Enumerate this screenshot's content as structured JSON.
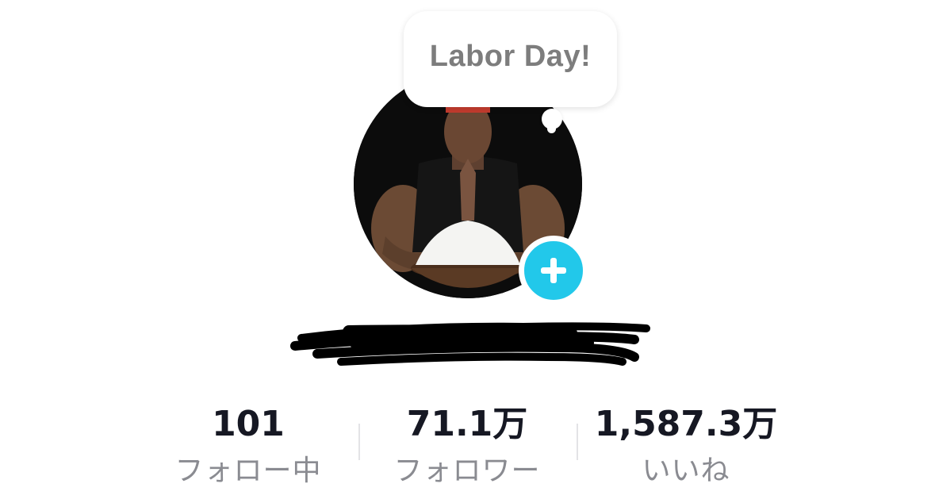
{
  "profile": {
    "bubble_text": "Labor Day!",
    "avatar_alt": "profile photo",
    "username_redacted": true
  },
  "stats": [
    {
      "value": "101",
      "label": "フォロー中"
    },
    {
      "value": "71.1万",
      "label": "フォロワー"
    },
    {
      "value": "1,587.3万",
      "label": "いいね"
    }
  ],
  "colors": {
    "follow_button": "#22c8ea",
    "stat_value": "#161823",
    "stat_label": "#8a8b91",
    "bubble_text": "#7d7d7d"
  },
  "icons": {
    "follow": "plus-icon"
  }
}
